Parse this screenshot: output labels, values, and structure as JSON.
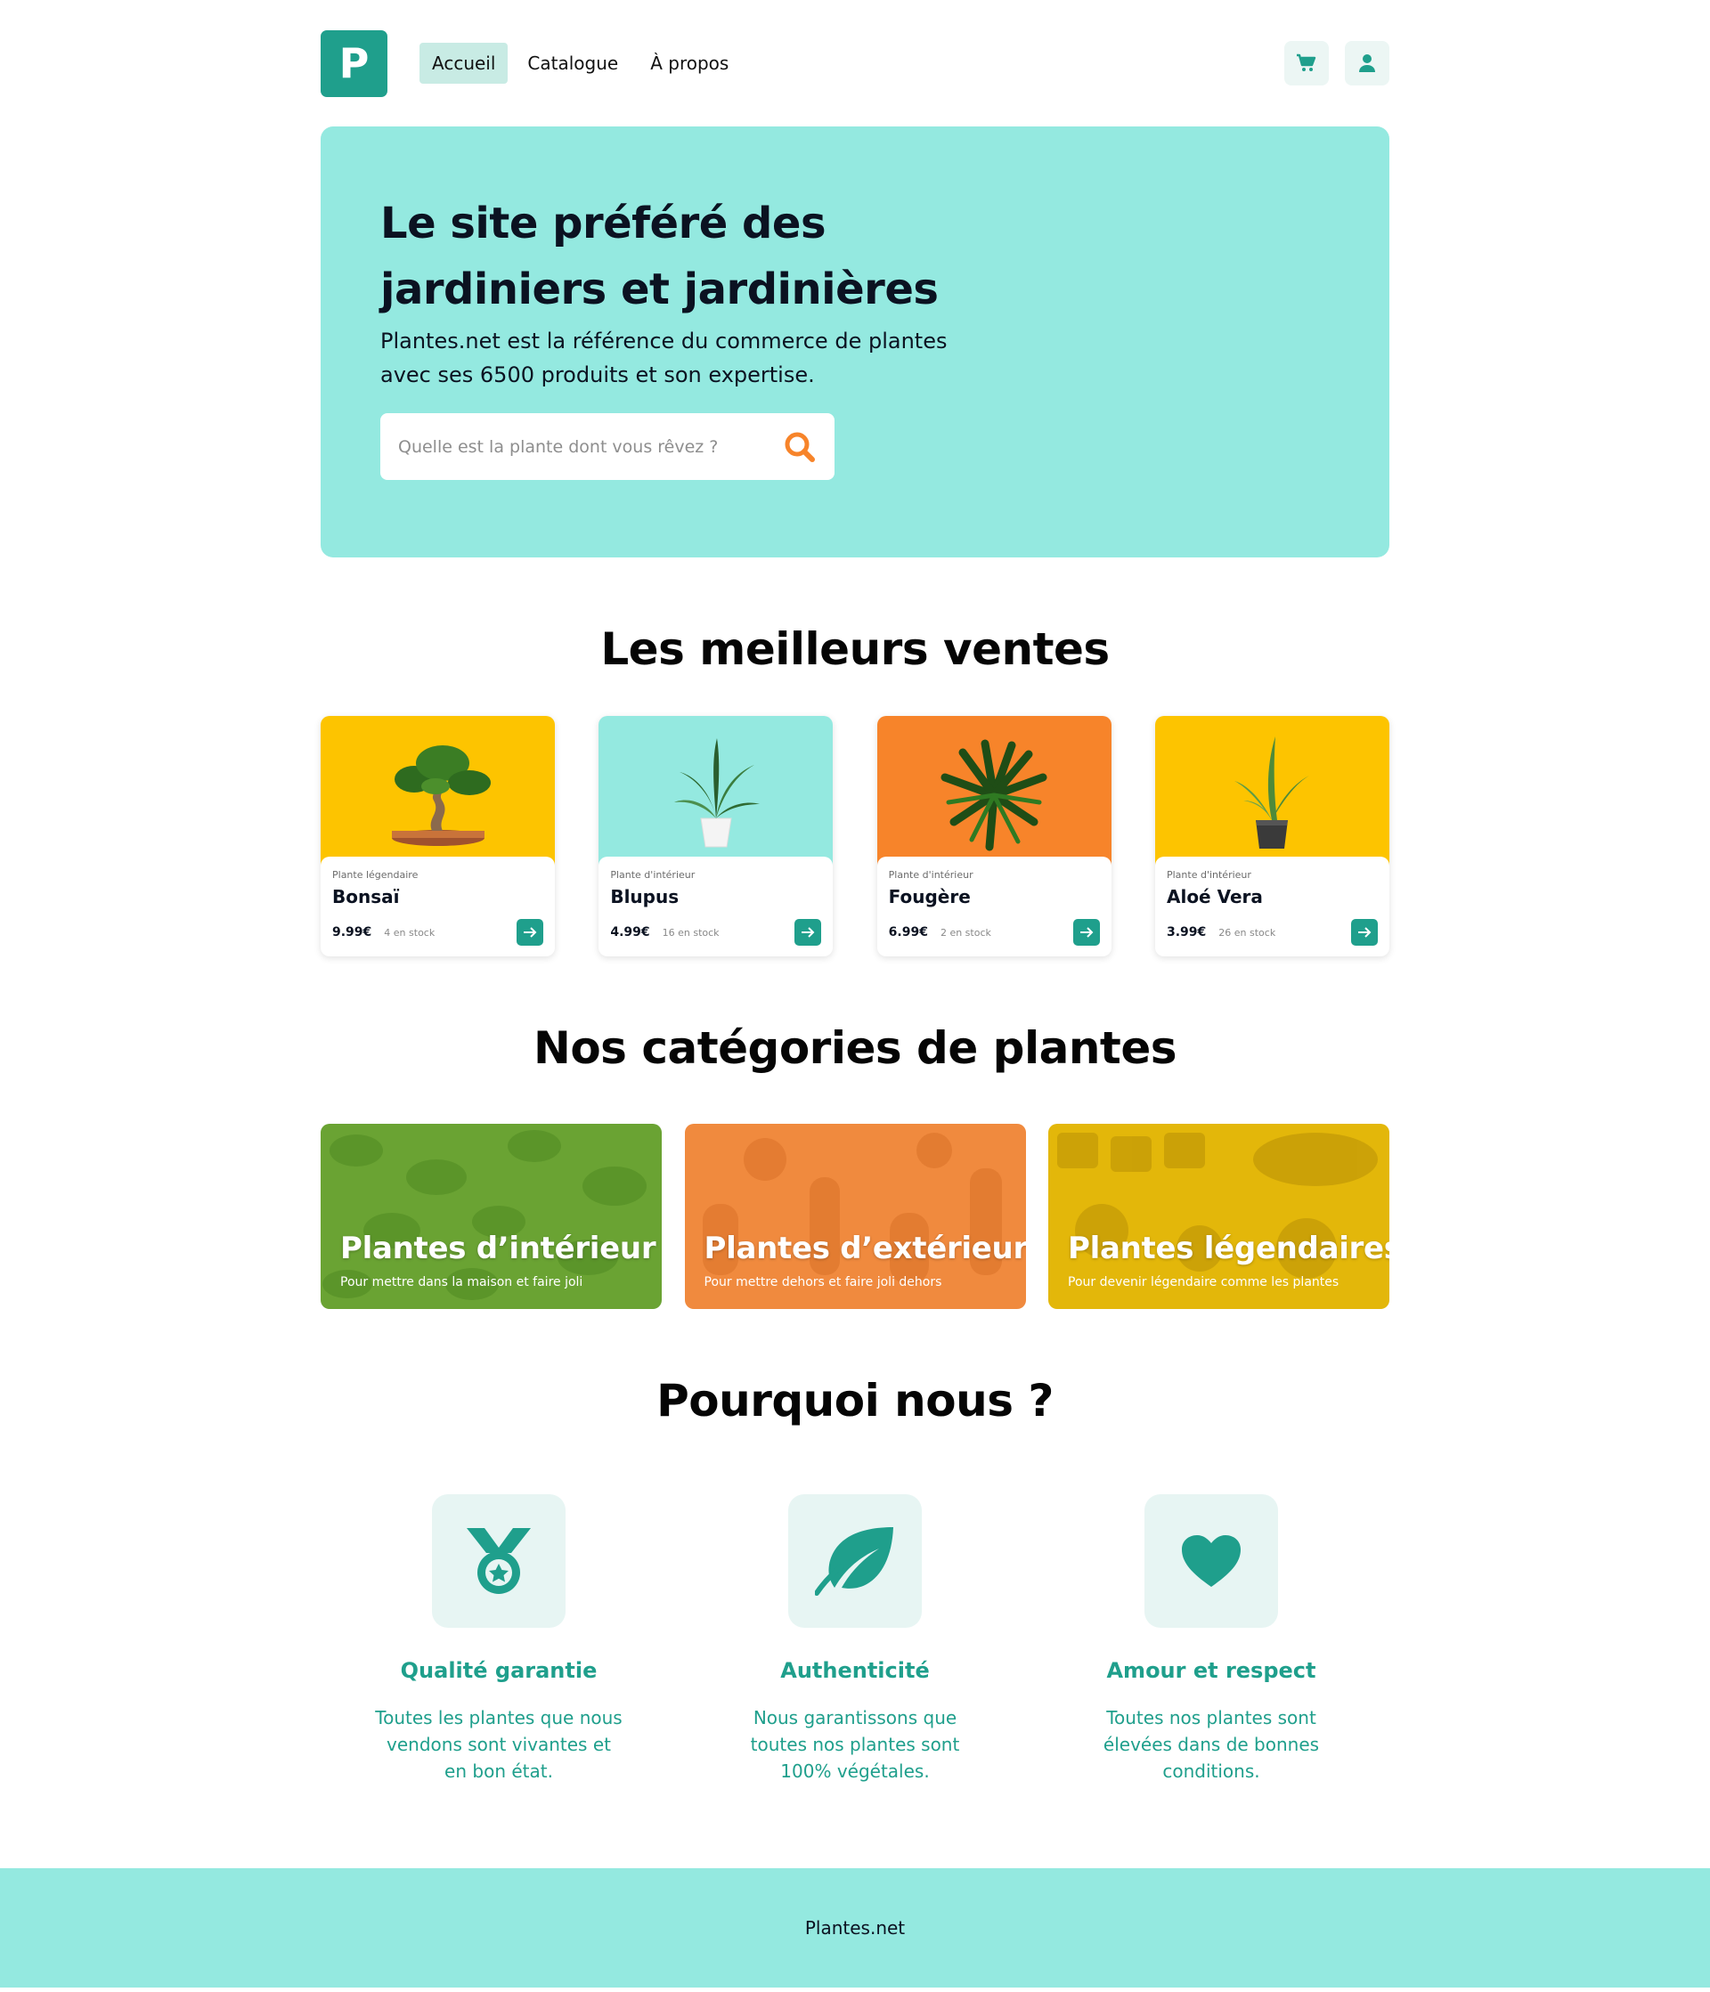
{
  "brand": {
    "logo_letter": "P",
    "accent": "#1f9f8c",
    "hero_bg": "#94e9e0"
  },
  "nav": {
    "items": [
      {
        "label": "Accueil",
        "active": true
      },
      {
        "label": "Catalogue",
        "active": false
      },
      {
        "label": "À propos",
        "active": false
      }
    ]
  },
  "header": {
    "icons": [
      "cart-icon",
      "user-icon"
    ]
  },
  "hero": {
    "title": "Le site préféré des jardiniers et jardinières",
    "text": "Plantes.net est la référence du commerce de plantes avec ses 6500 produits et son expertise.",
    "search_placeholder": "Quelle est la plante dont vous rêvez ?",
    "search_value": ""
  },
  "bestsellers": {
    "title": "Les meilleurs ventes",
    "products": [
      {
        "category": "Plante légendaire",
        "name": "Bonsaï",
        "price": "9.99€",
        "stock": "4 en stock",
        "bg": "#fdc400"
      },
      {
        "category": "Plante d'intérieur",
        "name": "Blupus",
        "price": "4.99€",
        "stock": "16 en stock",
        "bg": "#94e9e0"
      },
      {
        "category": "Plante d'intérieur",
        "name": "Fougère",
        "price": "6.99€",
        "stock": "2 en stock",
        "bg": "#f7842a"
      },
      {
        "category": "Plante d'intérieur",
        "name": "Aloé Vera",
        "price": "3.99€",
        "stock": "26 en stock",
        "bg": "#fdc400"
      }
    ]
  },
  "categories": {
    "title": "Nos catégories de plantes",
    "items": [
      {
        "title": "Plantes d’intérieur",
        "subtitle": "Pour mettre dans la maison et faire joli",
        "color": "#6aa333"
      },
      {
        "title": "Plantes d’extérieur",
        "subtitle": "Pour mettre dehors et faire joli dehors",
        "color": "#f08a3e"
      },
      {
        "title": "Plantes légendaires",
        "subtitle": "Pour devenir légendaire comme les plantes",
        "color": "#e3b70a"
      }
    ]
  },
  "why": {
    "title": "Pourquoi nous ?",
    "items": [
      {
        "icon": "medal-icon",
        "title": "Qualité garantie",
        "text": "Toutes les plantes que nous vendons sont vivantes et en bon état."
      },
      {
        "icon": "leaf-icon",
        "title": "Authenticité",
        "text": "Nous garantissons que toutes nos plantes sont 100% végétales."
      },
      {
        "icon": "heart-icon",
        "title": "Amour et respect",
        "text": "Toutes nos plantes sont élevées dans de bonnes conditions."
      }
    ]
  },
  "footer": {
    "text": "Plantes.net"
  }
}
